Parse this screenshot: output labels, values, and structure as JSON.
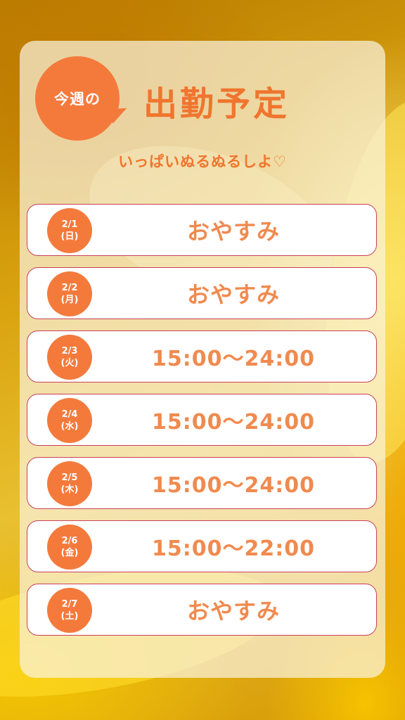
{
  "header": {
    "badge": "今週の",
    "title": "出勤予定",
    "subtitle": "いっぱいぬるぬるしよ♡"
  },
  "schedule": [
    {
      "date": "2/1",
      "weekday": "(日)",
      "value": "おやすみ",
      "type": "off"
    },
    {
      "date": "2/2",
      "weekday": "(月)",
      "value": "おやすみ",
      "type": "off"
    },
    {
      "date": "2/3",
      "weekday": "(火)",
      "value": "15:00〜24:00",
      "type": "time"
    },
    {
      "date": "2/4",
      "weekday": "(水)",
      "value": "15:00〜24:00",
      "type": "time"
    },
    {
      "date": "2/5",
      "weekday": "(木)",
      "value": "15:00〜24:00",
      "type": "time"
    },
    {
      "date": "2/6",
      "weekday": "(金)",
      "value": "15:00〜22:00",
      "type": "time"
    },
    {
      "date": "2/7",
      "weekday": "(土)",
      "value": "おやすみ",
      "type": "off"
    }
  ],
  "colors": {
    "accent": "#f47a3c",
    "text_orange": "#f0752e",
    "row_border": "#c7405a",
    "background": "#e2b01c"
  }
}
